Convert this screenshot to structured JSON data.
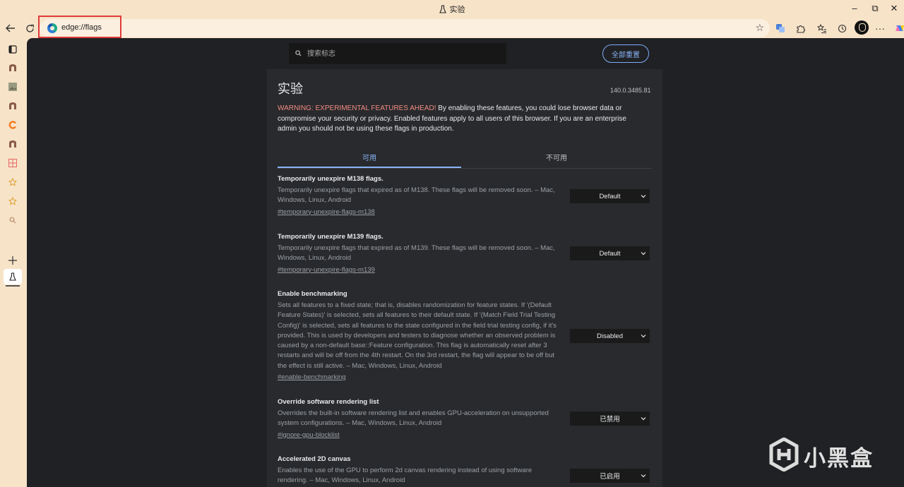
{
  "window": {
    "title": "实验"
  },
  "address": {
    "url": "edge://flags"
  },
  "page": {
    "search_placeholder": "搜索标志",
    "reset_label": "全部重置",
    "title": "实验",
    "version": "140.0.3485.81",
    "warning_prefix": "WARNING: EXPERIMENTAL FEATURES AHEAD!",
    "warning_body": " By enabling these features, you could lose browser data or compromise your security or privacy. Enabled features apply to all users of this browser. If you are an enterprise admin you should not be using these flags in production.",
    "tabs": [
      {
        "label": "可用"
      },
      {
        "label": "不可用"
      }
    ],
    "flags": [
      {
        "name": "Temporarily unexpire M138 flags.",
        "desc": "Temporarily unexpire flags that expired as of M138. These flags will be removed soon. – Mac, Windows, Linux, Android",
        "link": "#temporary-unexpire-flags-m138",
        "value": "Default"
      },
      {
        "name": "Temporarily unexpire M139 flags.",
        "desc": "Temporarily unexpire flags that expired as of M139. These flags will be removed soon. – Mac, Windows, Linux, Android",
        "link": "#temporary-unexpire-flags-m139",
        "value": "Default"
      },
      {
        "name": "Enable benchmarking",
        "desc": "Sets all features to a fixed state; that is, disables randomization for feature states. If '(Default Feature States)' is selected, sets all features to their default state. If '(Match Field Trial Testing Config)' is selected, sets all features to the state configured in the field trial testing config, if it's provided. This is used by developers and testers to diagnose whether an observed problem is caused by a non-default base::Feature configuration. This flag is automatically reset after 3 restarts and will be off from the 4th restart. On the 3rd restart, the flag will appear to be off but the effect is still active. – Mac, Windows, Linux, Android",
        "link": "#enable-benchmarking",
        "value": "Disabled"
      },
      {
        "name": "Override software rendering list",
        "desc": "Overrides the built-in software rendering list and enables GPU-acceleration on unsupported system configurations. – Mac, Windows, Linux, Android",
        "link": "#ignore-gpu-blocklist",
        "value": "已禁用"
      },
      {
        "name": "Accelerated 2D canvas",
        "desc": "Enables the use of the GPU to perform 2d canvas rendering instead of using software rendering. – Mac, Windows, Linux, Android",
        "link": "",
        "value": "已启用"
      }
    ]
  },
  "watermark": {
    "text": "小黑盒"
  }
}
